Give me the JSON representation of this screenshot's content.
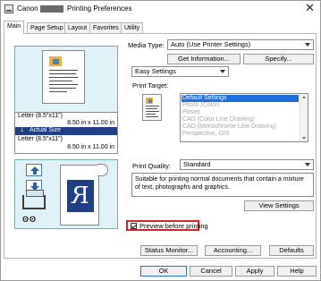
{
  "window": {
    "title_brand": "Canon",
    "title_suffix": "Printing Preferences",
    "close_glyph": "✕"
  },
  "tabs": [
    {
      "label": "Main",
      "active": true
    },
    {
      "label": "Page Setup",
      "active": false
    },
    {
      "label": "Layout",
      "active": false
    },
    {
      "label": "Favorites",
      "active": false
    },
    {
      "label": "Utility",
      "active": false
    }
  ],
  "preview": {
    "paper_size_line1": "Letter (8.5\"x11\")",
    "paper_size_line2": "8.50 in x 11.00 in",
    "actual_size": "Actual Size",
    "output_size_line1": "Letter (8.5\"x11\")",
    "output_size_line2": "8.50 in x 11.00 in",
    "rollers_glyph": "ʘʘ",
    "output_letter": "R"
  },
  "media_type": {
    "label": "Media Type:",
    "value": "Auto (Use Printer Settings)"
  },
  "buttons": {
    "get_information": "Get Information...",
    "specify": "Specify...",
    "view_settings": "View Settings",
    "status_monitor": "Status Monitor...",
    "accounting": "Accounting...",
    "defaults": "Defaults",
    "ok": "OK",
    "cancel": "Cancel",
    "apply": "Apply",
    "help": "Help"
  },
  "settings_mode": {
    "value": "Easy Settings"
  },
  "print_target": {
    "label": "Print Target:",
    "items": [
      {
        "label": "Default Settings",
        "selected": true
      },
      {
        "label": "Photo (Color)",
        "selected": false
      },
      {
        "label": "Poster",
        "selected": false
      },
      {
        "label": "CAD (Color Line Drawing)",
        "selected": false
      },
      {
        "label": "CAD (Monochrome Line Drawing)",
        "selected": false
      },
      {
        "label": "Perspective, GIS",
        "selected": false
      }
    ]
  },
  "print_quality": {
    "label": "Print Quality:",
    "value": "Standard"
  },
  "description": "Suitable for printing normal documents that contain a mixture of text, photographs and graphics.",
  "preview_before_printing": {
    "label": "Preview before printing",
    "checked": true
  },
  "colors": {
    "selection": "#1e6fd9",
    "highlight_border": "#d3262c",
    "actual_size_bg": "#1f3f86",
    "preview_bg": "#dff2f7"
  }
}
